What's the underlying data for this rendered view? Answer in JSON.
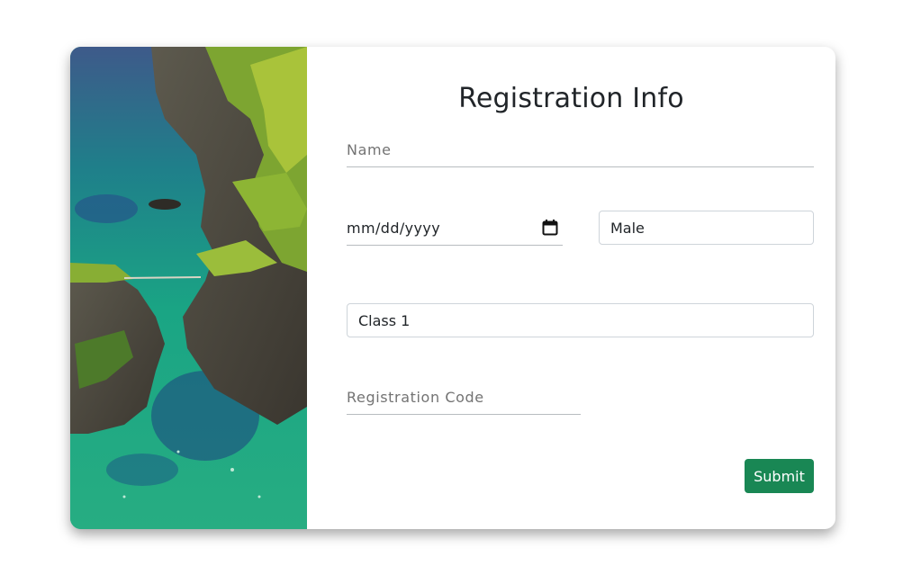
{
  "image": {
    "description_icon": "coastal-cliffs-rope-bridge-photo"
  },
  "form": {
    "title": "Registration Info",
    "name_placeholder": "Name",
    "date_value": "mm/dd/yyyy",
    "gender_selected": "Male",
    "class_selected": "Class 1",
    "registration_code_placeholder": "Registration Code",
    "submit_label": "Submit"
  },
  "colors": {
    "submit_bg": "#198754",
    "title_text": "#212529",
    "placeholder_text": "#737373"
  }
}
